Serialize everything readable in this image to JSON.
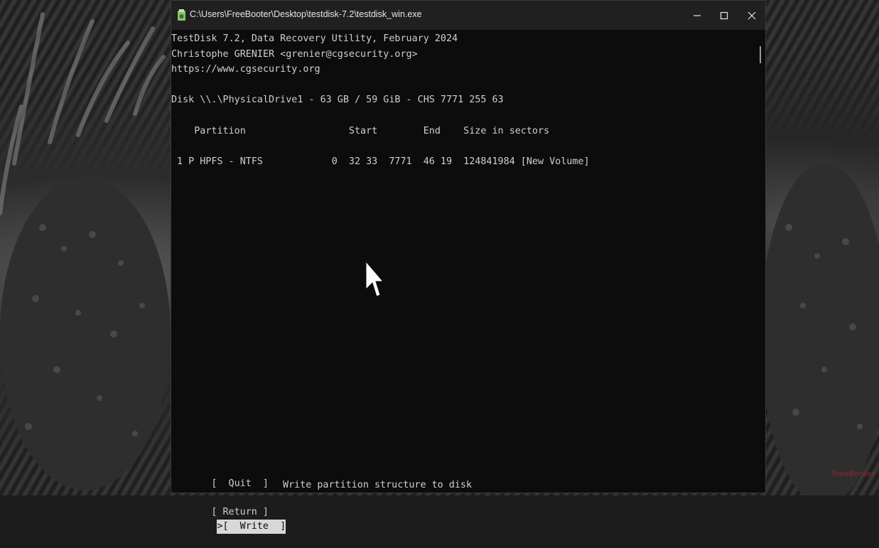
{
  "window": {
    "title": "C:\\Users\\FreeBooter\\Desktop\\testdisk-7.2\\testdisk_win.exe",
    "controls": {
      "minimize": "–",
      "maximize": "☐",
      "close": "X"
    }
  },
  "console": {
    "header": [
      "TestDisk 7.2, Data Recovery Utility, February 2024",
      "Christophe GRENIER <grenier@cgsecurity.org>",
      "https://www.cgsecurity.org"
    ],
    "disk_line": "Disk \\\\.\\PhysicalDrive1 - 63 GB / 59 GiB - CHS 7771 255 63",
    "table_header": "    Partition                  Start        End    Size in sectors",
    "partitions": [
      " 1 P HPFS - NTFS            0  32 33  7771  46 19  124841984 [New Volume]"
    ],
    "menu": {
      "quit": "[  Quit  ]",
      "return": "[ Return ]",
      "write_prefix": ">",
      "write": "[  Write  ]",
      "write_hint": "Write partition structure to disk"
    }
  },
  "watermark": "FreeBooter"
}
